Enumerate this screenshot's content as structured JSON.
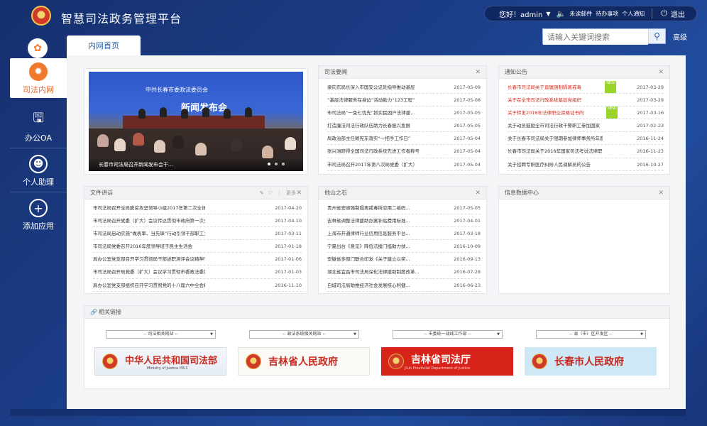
{
  "app": {
    "title": "智慧司法政务管理平台"
  },
  "userbar": {
    "greeting": "您好！admin",
    "links": [
      "未读邮件",
      "待办事项",
      "个人通知"
    ],
    "logout": "退出"
  },
  "sidebar": {
    "items": [
      {
        "label": "司法内网",
        "icon": "network-icon",
        "active": true
      },
      {
        "label": "办公OA",
        "icon": "monitor-icon",
        "active": false
      },
      {
        "label": "个人助理",
        "icon": "user-icon",
        "active": false
      },
      {
        "label": "添加应用",
        "icon": "plus-icon",
        "active": false
      }
    ]
  },
  "tabs": {
    "home": "内网首页"
  },
  "search": {
    "placeholder": "请输入关键词搜索",
    "advanced": "高级"
  },
  "news": {
    "photo_banner": "中共长春市委政法委员会",
    "photo_title": "新闻发布会",
    "caption": "长春市司法局召开新闻发布会干..."
  },
  "sifa_news": {
    "title": "司法要闻",
    "items": [
      {
        "text": "梁向东局长深入市国安公证处指导推动基层",
        "date": "2017-05-09"
      },
      {
        "text": "“基层法律服务在身边”活动助力“123工程”",
        "date": "2017-05-08"
      },
      {
        "text": "市司法局“一免七优先”抓实民困户法律援...",
        "date": "2017-05-05"
      },
      {
        "text": "打造廉洁司法行政队伍助力长春振兴发展",
        "date": "2017-05-05"
      },
      {
        "text": "局政治部主任赖宪东落实“一把手工作日”",
        "date": "2017-05-04"
      },
      {
        "text": "张兴洲跻得全国司法行政系统先进工作者称号",
        "date": "2017-05-04"
      },
      {
        "text": "市司法局召开2017年第八次局党委（扩大）",
        "date": "2017-05-04"
      }
    ]
  },
  "notices": {
    "title": "通知公告",
    "badge": "NEW",
    "items": [
      {
        "text": "长春市司法局关于直属强制隔离戒毒",
        "date": "2017-03-29",
        "red": true,
        "new": true
      },
      {
        "text": "关于在全市司法行政系统基层党组织",
        "date": "2017-03-29",
        "red": true,
        "new": false
      },
      {
        "text": "关于转发2016年法律职业资格证书的",
        "date": "2017-03-16",
        "red": true,
        "new": true
      },
      {
        "text": "关于动员鼓励全市司法行政干警职工参加国家",
        "date": "2017-02-23",
        "red": false,
        "new": false
      },
      {
        "text": "关于长春市司法局关于限期参加律师事务所年度检",
        "date": "2016-11-24",
        "red": false,
        "new": false
      },
      {
        "text": "长春市司法局关于2016年国家司法考试法律职",
        "date": "2016-11-23",
        "red": false,
        "new": false
      },
      {
        "text": "关于招聘专职医疗纠纷人民调解员的公告",
        "date": "2016-10-27",
        "red": false,
        "new": false
      }
    ]
  },
  "speeches": {
    "title": "文件讲话",
    "more": "更多",
    "items": [
      {
        "text": "市司法局召开全局脱贫攻坚领导小组2017年第二次全体会议",
        "date": "2017-04-20"
      },
      {
        "text": "市司法局召开党委（扩大）会议传达贯彻市政府第一次全体会议精神",
        "date": "2017-04-10"
      },
      {
        "text": "市司法局启动实施“做表率、当先锋”行动引领干部职工立足岗位做贡献",
        "date": "2017-03-11"
      },
      {
        "text": "市司法局党委召开2016年度领导班子民主生活会",
        "date": "2017-01-18"
      },
      {
        "text": "局办公室党支部召开学习贯彻局干部述职测评会议精神专题会议",
        "date": "2017-01-06"
      },
      {
        "text": "市司法局召开局党委（扩大）会议学习贯彻市委政法委第五次全...",
        "date": "2017-01-03"
      },
      {
        "text": "局办公室党支部组织召开学习贯彻党的十八届六中全会精神专题会议",
        "date": "2016-11-10"
      }
    ]
  },
  "other_stones": {
    "title": "他山之石",
    "items": [
      {
        "text": "贵州省安顺强制隔离戒毒所应用二维码...",
        "date": "2017-05-05"
      },
      {
        "text": "吉林省调整法律援助办案补贴费用标准...",
        "date": "2017-04-01"
      },
      {
        "text": "上海市开通律师行业信用信息服务平台...",
        "date": "2017-03-18"
      },
      {
        "text": "宁夏出台《意见》降低法援门槛助力扶...",
        "date": "2016-10-09"
      },
      {
        "text": "安徽省多部门联合印发《关于建立以奖...",
        "date": "2016-09-13"
      },
      {
        "text": "湖北省宜昌市司法局深化法律援助制度改革...",
        "date": "2016-07-28"
      },
      {
        "text": "白城司法局助推经济社会发展核心利健...",
        "date": "2016-06-23"
      }
    ]
  },
  "info_center": {
    "title": "信息数据中心"
  },
  "related_links": {
    "title": "相关链接",
    "selects": [
      "-- 司法相关网站 --",
      "-- 政法系统相关网站 --",
      "-- 市委统一战线工作部 --",
      "-- 县（市）区开发区 --"
    ],
    "logos": [
      {
        "text": "中华人民共和国司法部",
        "sub": "Ministry of Justice P.R.C"
      },
      {
        "text": "吉林省人民政府",
        "sub": ""
      },
      {
        "text": "吉林省司法厅",
        "sub": "JiLin Provincial Department of Justice"
      },
      {
        "text": "长春市人民政府",
        "sub": ""
      }
    ]
  },
  "colors": {
    "accent": "#ef7a2c",
    "brand_blue": "#2b5ea8",
    "alert_red": "#d42b1e",
    "badge_green": "#9bd429"
  }
}
